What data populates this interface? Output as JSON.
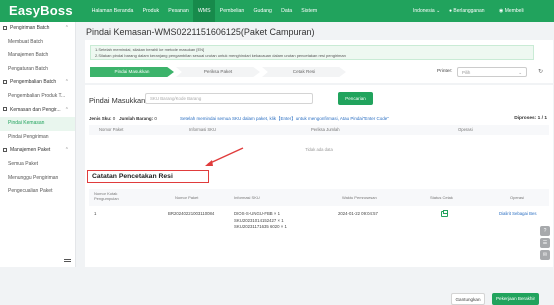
{
  "app": {
    "logo": "EasyBoss"
  },
  "nav": {
    "items": [
      "Halaman Beranda",
      "Produk",
      "Pesanan",
      "WMS",
      "Pembelian",
      "Gudang",
      "Data",
      "Sistem"
    ],
    "active": "WMS"
  },
  "topbar": {
    "language": "Indonesia",
    "subscription": "Berlangganan",
    "member": "Membeli"
  },
  "sidebar": [
    {
      "type": "group",
      "label": "Pengiriman Batch",
      "expanded": true
    },
    {
      "type": "item",
      "label": "Membuat Batch"
    },
    {
      "type": "item",
      "label": "Manajemen Batch"
    },
    {
      "type": "item",
      "label": "Pengaturan Batch"
    },
    {
      "type": "group",
      "label": "Pengembalian Batch",
      "expanded": true
    },
    {
      "type": "item",
      "label": "Pengembalian Produk T..."
    },
    {
      "type": "group",
      "label": "Kemasan dan Pengir...",
      "expanded": true
    },
    {
      "type": "item",
      "label": "Pindai Kemasan",
      "active": true
    },
    {
      "type": "item",
      "label": "Pindai Pengiriman"
    },
    {
      "type": "group",
      "label": "Manajemen Paket",
      "expanded": true
    },
    {
      "type": "item",
      "label": "Semua Paket"
    },
    {
      "type": "item",
      "label": "Menunggu Pengiriman"
    },
    {
      "type": "item",
      "label": "Pengecualian Paket"
    }
  ],
  "page": {
    "title": "Pindai Kemasan-WMS0221151606125(Paket Campuran)"
  },
  "notes": [
    "1.Setelah memindai, silakan berahli ke metode masukan [EN]",
    "2.Silakan pindai barang dalam keranjang pengambilan sesuai urutan untuk menghindari kekacauan dalam urutan pencetakan resi pengiriman"
  ],
  "steps": [
    "Pindai Masukkan",
    "Periksa Paket",
    "Cetak Resi"
  ],
  "printer": {
    "label": "Printer:",
    "placeholder": "Pilih"
  },
  "scan": {
    "label": "Pindai Masukkan",
    "placeholder": "SKU Barang/Kode Barang",
    "button": "Pencarian"
  },
  "stats": {
    "jenis_label": "Jenis Sku:",
    "jenis_value": "0",
    "jumlah_label": "Jumlah Barang:",
    "jumlah_value": "0",
    "hint": "Setelah memindai semua SKU dalam paket, klik【Enter】untuk mengonfirmasi, Atau Pindai\"Enter Code\"",
    "processed_label": "Diproses:",
    "processed_value": "1 / 1"
  },
  "table1": {
    "headers": [
      "Nomor Paket",
      "Informasi SKU",
      "Periksa Jumlah",
      "Operasi"
    ],
    "empty_text": "Tidak ada data"
  },
  "history": {
    "title": "Catatan Pencetakan Resi",
    "headers": [
      "Nomor Kotak Pengumpulan",
      "Nomor Paket",
      "Informasi SKU",
      "Waktu Pemrosesan",
      "Status Cetak",
      "Operasi"
    ],
    "rows": [
      {
        "box": "1",
        "package": "BR20240221003110084",
        "sku_lines": [
          "DIOS-S-UNGU-FBB × 1",
          "SKU20231014152427 × 1",
          "SKU20231171635 6020 × 1"
        ],
        "time": "2024-01-22 09:04:57",
        "status": "printer-icon",
        "action": "Dialirit Sebagai Bes"
      }
    ]
  },
  "buttons": {
    "ganti": "Gantungkan",
    "next": "Pekerjaan Berakhir"
  },
  "colors": {
    "brand": "#21a35d",
    "highlight": "#e03c3c",
    "link": "#2b6fc2"
  }
}
